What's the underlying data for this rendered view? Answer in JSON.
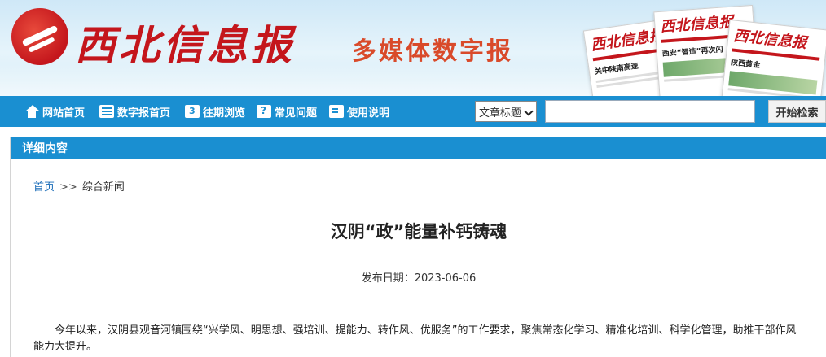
{
  "header": {
    "paper_name": "西北信息报",
    "subtitle": "多媒体数字报",
    "mini_papers": [
      {
        "mast": "西北信息报",
        "headline": "关中陕南高速"
      },
      {
        "mast": "西北信息报",
        "headline": "西安“智造”再次闪"
      },
      {
        "mast": "西北信息报",
        "headline": "陕西黄金"
      }
    ]
  },
  "nav": {
    "items": [
      {
        "label": "网站首页",
        "icon": "home-icon"
      },
      {
        "label": "数字报首页",
        "icon": "newspaper-icon"
      },
      {
        "label": "往期浏览",
        "icon": "calendar-icon"
      },
      {
        "label": "常见问题",
        "icon": "question-icon"
      },
      {
        "label": "使用说明",
        "icon": "document-icon"
      }
    ],
    "search_field_selected": "文章标题",
    "search_button": "开始检索"
  },
  "panel": {
    "heading": "详细内容",
    "breadcrumb": {
      "home": "首页",
      "separator": ">>",
      "section": "综合新闻"
    },
    "article_title": "汉阴“政”能量补钙铸魂",
    "publish_date": "发布日期：2023-06-06",
    "body": "今年以来，汉阴县观音河镇围绕“兴学风、明思想、强培训、提能力、转作风、优服务”的工作要求，聚焦常态化学习、精准化培训、科学化管理，助推干部作风能力大提升。"
  },
  "colors": {
    "nav_blue": "#1a8fd1",
    "brand_red": "#c4161c"
  }
}
